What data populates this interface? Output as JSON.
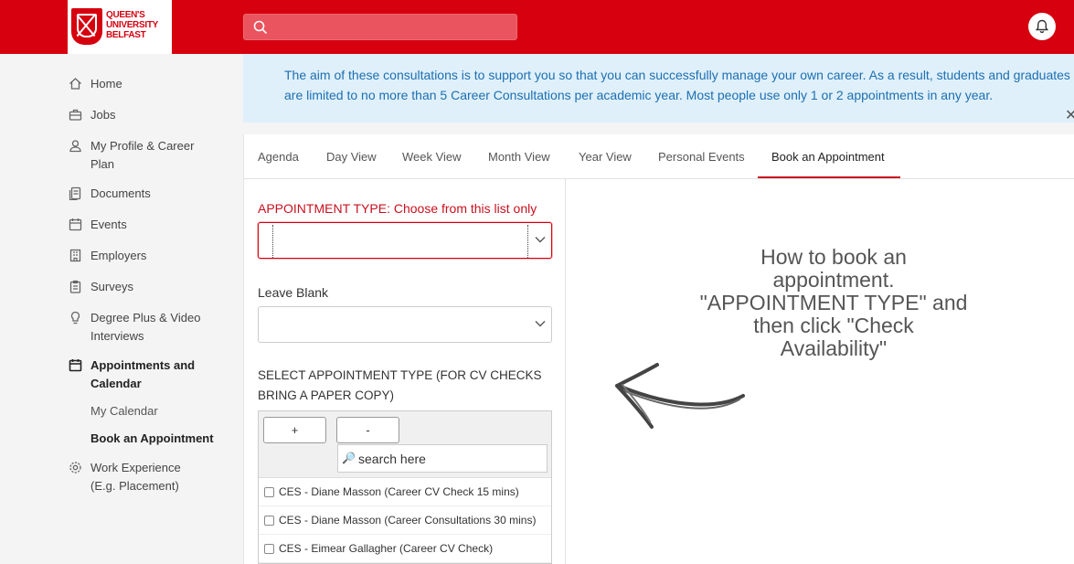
{
  "header": {
    "logo_lines": [
      "QUEEN'S",
      "UNIVERSITY",
      "BELFAST"
    ],
    "search_value": ""
  },
  "sidebar": {
    "items": [
      {
        "label": "Home",
        "icon": "home-icon"
      },
      {
        "label": "Jobs",
        "icon": "briefcase-icon"
      },
      {
        "label": "My Profile & Career Plan",
        "line1": "My Profile & Career",
        "line2": "Plan",
        "icon": "user-icon"
      },
      {
        "label": "Documents",
        "icon": "document-icon"
      },
      {
        "label": "Events",
        "icon": "calendar-icon"
      },
      {
        "label": "Employers",
        "icon": "building-icon"
      },
      {
        "label": "Surveys",
        "icon": "clipboard-icon"
      },
      {
        "label": "Degree Plus & Video Interviews",
        "line1": "Degree Plus & Video",
        "line2": "Interviews",
        "icon": "lightbulb-icon"
      },
      {
        "label": "Appointments and Calendar",
        "line1": "Appointments and",
        "line2": "Calendar",
        "icon": "calendar-icon"
      },
      {
        "label": "Work Experience (E.g. Placement)",
        "line1": "Work Experience",
        "line2": "(E.g. Placement)",
        "icon": "gear-icon"
      }
    ],
    "sub_items": [
      "My Calendar",
      "Book an Appointment"
    ]
  },
  "banner": {
    "line1": "The aim of these consultations is to support you so that you can successfully manage your own career. As a result, students and graduates",
    "line2": "are limited to no more than 5 Career Consultations per academic year. Most people use only 1 or 2 appointments in any year.",
    "close": "✕"
  },
  "tabs": [
    "Agenda",
    "Day View",
    "Week View",
    "Month View",
    "Year View",
    "Personal Events",
    "Book an Appointment"
  ],
  "form": {
    "appointment_type_label": "APPOINTMENT TYPE: Choose from this list only",
    "leave_blank_label": "Leave Blank",
    "select_type_line1": "SELECT APPOINTMENT TYPE (FOR CV CHECKS",
    "select_type_line2": "BRING A PAPER COPY)",
    "plus_button": "+",
    "minus_button": "-",
    "search_placeholder": "search here",
    "search_icon": "🔎",
    "options": [
      "CES - Diane Masson (Career CV Check 15 mins)",
      "CES - Diane Masson (Career Consultations 30 mins)",
      "CES - Eimear Gallagher (Career CV Check)"
    ]
  },
  "help": {
    "line1": "How to book an",
    "line2": "appointment.",
    "line3": "\"APPOINTMENT TYPE\" and",
    "line4": "then click \"Check",
    "line5": "Availability\""
  },
  "colors": {
    "brand_red": "#d6000f",
    "banner_bg": "#dff0fb",
    "banner_text": "#1d6fb0"
  }
}
